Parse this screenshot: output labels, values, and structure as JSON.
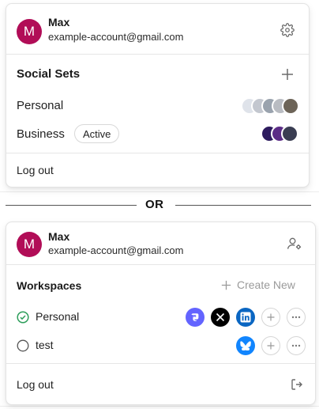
{
  "colors": {
    "avatar_bg": "#b10d57",
    "active_check": "#2e9e5b",
    "mastodon": "#6364ff",
    "x": "#000000",
    "linkedin": "#0a66c2",
    "bluesky": "#1185fe"
  },
  "card1": {
    "user": {
      "initial": "M",
      "name": "Max",
      "email": "example-account@gmail.com"
    },
    "settings_icon": "gear-icon",
    "section_title": "Social Sets",
    "add_icon": "plus-icon",
    "sets": [
      {
        "label": "Personal",
        "badge": ""
      },
      {
        "label": "Business",
        "badge": "Active"
      }
    ],
    "logout_label": "Log out"
  },
  "separator": {
    "text": "OR"
  },
  "card2": {
    "user": {
      "initial": "M",
      "name": "Max",
      "email": "example-account@gmail.com"
    },
    "account_settings_icon": "user-gear-icon",
    "section_title": "Workspaces",
    "create_new_label": "Create New",
    "workspaces": [
      {
        "label": "Personal",
        "selected": true,
        "accounts": [
          "mastodon-icon",
          "x-icon",
          "linkedin-icon"
        ]
      },
      {
        "label": "test",
        "selected": false,
        "accounts": [
          "bluesky-icon"
        ]
      }
    ],
    "logout_label": "Log out",
    "logout_icon": "logout-icon"
  }
}
